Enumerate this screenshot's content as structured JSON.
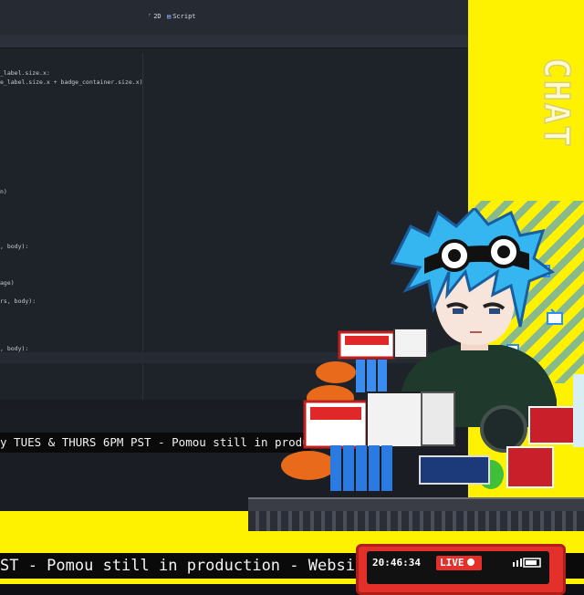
{
  "editor": {
    "tabs": [
      {
        "label": "2D",
        "icon": "2d-icon"
      },
      {
        "label": "Script",
        "icon": "script-icon"
      }
    ],
    "code_lines": [
      "_label.size.x:",
      "e_label.size.x + badge_container.size.x)",
      "n)",
      ", body):",
      "age)",
      "rs, body):",
      ", body):"
    ]
  },
  "ticker_top": "y TUES & THURS 6PM PST - Pomou still in production",
  "ticker_bottom": "ST - Pomou still in production - Website i",
  "chat_label": "CHAT",
  "camera": {
    "time": "20:46:34",
    "live_label": "LIVE"
  },
  "colors": {
    "yellow": "#fff200",
    "editor_bg": "#1e2229",
    "accent_blue": "#2a8cff",
    "live_red": "#e4302a"
  }
}
